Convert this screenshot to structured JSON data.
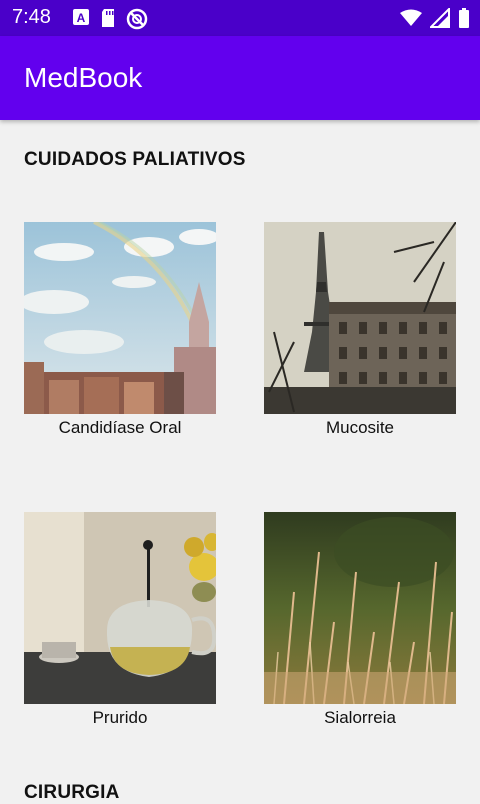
{
  "status_bar": {
    "time": "7:48",
    "icons": [
      "a-box-icon",
      "sd-card-icon",
      "no-data-icon",
      "wifi-icon",
      "signal-icon",
      "battery-icon"
    ]
  },
  "app_bar": {
    "title": "MedBook"
  },
  "sections": [
    {
      "title": "CUIDADOS PALIATIVOS",
      "items": [
        {
          "label": "Candidíase Oral"
        },
        {
          "label": "Mucosite"
        },
        {
          "label": "Prurido"
        },
        {
          "label": "Sialorreia"
        }
      ]
    },
    {
      "title": "CIRURGIA"
    }
  ],
  "colors": {
    "status_bar": "#4a00c9",
    "app_bar": "#6200ee",
    "background": "#f1f1f1"
  }
}
